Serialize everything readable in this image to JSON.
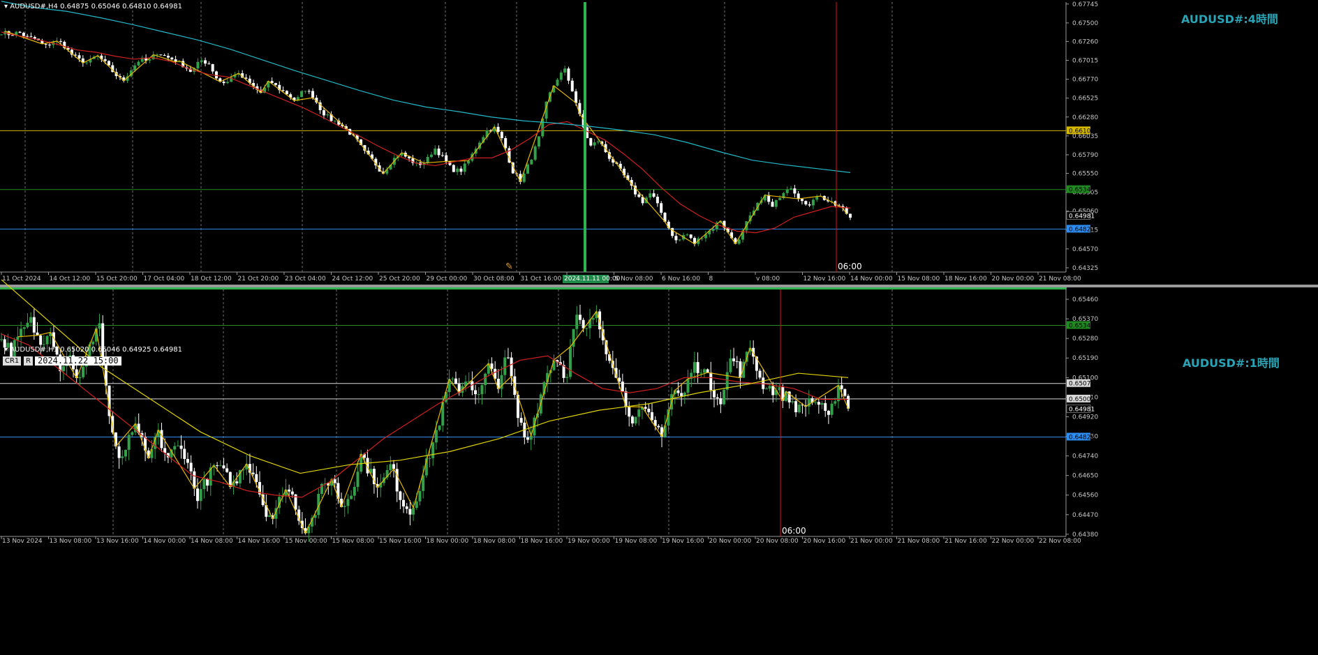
{
  "colors": {
    "bg": "#000000",
    "grid": "#6e6e6e",
    "up": "#33a04a",
    "down": "#ffffff",
    "zigzag": "#e6b800",
    "ma_fast": "#d11f1f",
    "ma_slow_h4": "#22b9c8",
    "ma_slow_h1": "#e0d400",
    "axis_text": "#c8c8c8",
    "title": "#2aa3b5",
    "marker": "#e01010",
    "vline": "#2fb34e"
  },
  "panels": [
    {
      "header": "AUDUSD#,H4  0.64875 0.65046 0.64810 0.64981",
      "title": "AUDUSD#:4時間",
      "vline_label": "06:00",
      "highlight_label": "2024.11.11 00:00"
    },
    {
      "header": "AUDUSD#,H1  0.65020 0.65046 0.64925 0.64981",
      "title": "AUDUSD#:1時間",
      "vline_label": "06:00",
      "tags": [
        "CR1",
        "R"
      ],
      "datetime": "2024.11.22 15:00"
    }
  ],
  "chart_data": [
    {
      "type": "candlestick",
      "timeframe": "H4",
      "symbol": "AUDUSD#",
      "yticks": [
        0.67745,
        0.675,
        0.6726,
        0.67015,
        0.6677,
        0.66525,
        0.6628,
        0.66035,
        0.6579,
        0.6555,
        0.65305,
        0.6506,
        0.64815,
        0.6457,
        0.64325
      ],
      "ylim": [
        0.6427,
        0.6777
      ],
      "xticks": [
        "11 Oct 2024",
        "14 Oct 12:00",
        "15 Oct 20:00",
        "17 Oct 04:00",
        "18 Oct 12:00",
        "21 Oct 20:00",
        "23 Oct 04:00",
        "24 Oct 12:00",
        "25 Oct 20:00",
        "29 Oct 00:00",
        "30 Oct 08:00",
        "31 Oct 16:00",
        "4 Nov 00:00",
        "5 Nov 08:00",
        "6 Nov 16:00",
        "8",
        "v 08:00",
        "12 Nov 16:00",
        "14 Nov 00:00",
        "15 Nov 08:00",
        "18 Nov 16:00",
        "20 Nov 00:00",
        "21 Nov 08:00"
      ],
      "close_path": [
        0.6738,
        0.6735,
        0.6738,
        0.6731,
        0.6729,
        0.6719,
        0.6726,
        0.6724,
        0.671,
        0.6702,
        0.6698,
        0.6708,
        0.6698,
        0.6685,
        0.6674,
        0.669,
        0.6703,
        0.67,
        0.6712,
        0.6706,
        0.6702,
        0.6695,
        0.6686,
        0.6702,
        0.6697,
        0.6675,
        0.6672,
        0.6685,
        0.6678,
        0.6668,
        0.6659,
        0.6675,
        0.6665,
        0.6658,
        0.6648,
        0.6665,
        0.6655,
        0.6635,
        0.6625,
        0.662,
        0.661,
        0.6598,
        0.6581,
        0.657,
        0.6555,
        0.657,
        0.6582,
        0.6574,
        0.6566,
        0.657,
        0.6588,
        0.6575,
        0.656,
        0.6558,
        0.6572,
        0.6593,
        0.661,
        0.6614,
        0.6595,
        0.6558,
        0.6545,
        0.657,
        0.6598,
        0.665,
        0.6675,
        0.669,
        0.666,
        0.662,
        0.659,
        0.6598,
        0.6578,
        0.6565,
        0.655,
        0.6532,
        0.6518,
        0.653,
        0.6508,
        0.6485,
        0.6465,
        0.6478,
        0.6464,
        0.6475,
        0.6482,
        0.6495,
        0.6475,
        0.6463,
        0.649,
        0.6508,
        0.6528,
        0.651,
        0.6528,
        0.654,
        0.6525,
        0.651,
        0.6528,
        0.6522,
        0.6515,
        0.651,
        0.6498
      ],
      "ma_fast_path": [
        0.6738,
        0.6733,
        0.6728,
        0.6722,
        0.6715,
        0.6712,
        0.6707,
        0.6703,
        0.6705,
        0.67,
        0.669,
        0.6683,
        0.668,
        0.667,
        0.666,
        0.665,
        0.664,
        0.6628,
        0.6615,
        0.6603,
        0.659,
        0.6578,
        0.6568,
        0.6565,
        0.657,
        0.6575,
        0.6575,
        0.6585,
        0.66,
        0.6618,
        0.6622,
        0.661,
        0.6598,
        0.658,
        0.656,
        0.6536,
        0.6515,
        0.65,
        0.6488,
        0.648,
        0.6478,
        0.6484,
        0.6498,
        0.6505,
        0.6512,
        0.651
      ],
      "ma_slow_path": [
        0.6778,
        0.677,
        0.6765,
        0.6757,
        0.6748,
        0.6738,
        0.6728,
        0.6716,
        0.6702,
        0.6688,
        0.6675,
        0.6662,
        0.665,
        0.6641,
        0.6635,
        0.6628,
        0.6623,
        0.662,
        0.6616,
        0.6611,
        0.6605,
        0.6595,
        0.6583,
        0.6572,
        0.6566,
        0.6561,
        0.6556
      ],
      "hlines": [
        {
          "y": 0.66103,
          "color": "#d4b800",
          "label": "0.66103"
        },
        {
          "y": 0.6534,
          "color": "#1f8a1f",
          "label": "0.65340"
        },
        {
          "y": 0.64827,
          "color": "#2d8cf0",
          "label": "0.64827"
        }
      ],
      "last_price": "0.64981"
    },
    {
      "type": "candlestick",
      "timeframe": "H1",
      "symbol": "AUDUSD#",
      "yticks": [
        0.6546,
        0.6537,
        0.6528,
        0.6519,
        0.651,
        0.6501,
        0.6492,
        0.6483,
        0.6474,
        0.6465,
        0.6456,
        0.6447,
        0.6438
      ],
      "ylim": [
        0.6437,
        0.65505
      ],
      "xticks": [
        "13 Nov 2024",
        "13 Nov 08:00",
        "13 Nov 16:00",
        "14 Nov 00:00",
        "14 Nov 08:00",
        "14 Nov 16:00",
        "15 Nov 00:00",
        "15 Nov 08:00",
        "15 Nov 16:00",
        "18 Nov 00:00",
        "18 Nov 08:00",
        "18 Nov 16:00",
        "19 Nov 00:00",
        "19 Nov 08:00",
        "19 Nov 16:00",
        "20 Nov 00:00",
        "20 Nov 08:00",
        "20 Nov 16:00",
        "21 Nov 00:00",
        "21 Nov 08:00",
        "21 Nov 16:00",
        "22 Nov 00:00",
        "22 Nov 08:00"
      ],
      "close_path": [
        0.6528,
        0.6522,
        0.653,
        0.6536,
        0.6525,
        0.6534,
        0.6515,
        0.652,
        0.6508,
        0.6522,
        0.6538,
        0.6495,
        0.647,
        0.648,
        0.6488,
        0.647,
        0.6485,
        0.6473,
        0.6478,
        0.6475,
        0.6455,
        0.6462,
        0.647,
        0.6465,
        0.646,
        0.6472,
        0.6466,
        0.645,
        0.6445,
        0.646,
        0.6455,
        0.644,
        0.6445,
        0.646,
        0.6464,
        0.645,
        0.6458,
        0.6475,
        0.6465,
        0.646,
        0.647,
        0.6455,
        0.6448,
        0.646,
        0.6475,
        0.649,
        0.6508,
        0.6505,
        0.651,
        0.65,
        0.6515,
        0.6507,
        0.652,
        0.6493,
        0.648,
        0.6495,
        0.6512,
        0.652,
        0.651,
        0.6538,
        0.653,
        0.654,
        0.6525,
        0.6515,
        0.65,
        0.649,
        0.6495,
        0.6488,
        0.6485,
        0.6505,
        0.65,
        0.6515,
        0.6515,
        0.6505,
        0.65,
        0.652,
        0.6512,
        0.6525,
        0.6508,
        0.6505,
        0.6503,
        0.65,
        0.6495,
        0.65,
        0.6498,
        0.649,
        0.6508,
        0.6498
      ],
      "ma_fast_path": [
        0.653,
        0.6525,
        0.6515,
        0.6505,
        0.6495,
        0.6485,
        0.6475,
        0.6465,
        0.6462,
        0.6458,
        0.6456,
        0.6455,
        0.6462,
        0.6472,
        0.6482,
        0.649,
        0.6498,
        0.6505,
        0.6512,
        0.6518,
        0.652,
        0.6512,
        0.6505,
        0.6503,
        0.6505,
        0.651,
        0.651,
        0.6508,
        0.6507,
        0.6505,
        0.65,
        0.65
      ],
      "ma_slow_path": [
        0.6555,
        0.6535,
        0.6515,
        0.65,
        0.6485,
        0.6474,
        0.6466,
        0.647,
        0.6472,
        0.6476,
        0.6482,
        0.649,
        0.6495,
        0.6498,
        0.6503,
        0.6507,
        0.6512,
        0.651
      ],
      "hlines": [
        {
          "y": 0.6534,
          "color": "#1f8a1f",
          "label": "0.65340"
        },
        {
          "y": 0.65073,
          "color": "#d8d8d8",
          "label": "0.65073"
        },
        {
          "y": 0.65002,
          "color": "#d8d8d8",
          "label": "0.65002"
        },
        {
          "y": 0.64827,
          "color": "#2d8cf0",
          "label": "0.64827"
        }
      ],
      "last_price": "0.64981"
    }
  ]
}
